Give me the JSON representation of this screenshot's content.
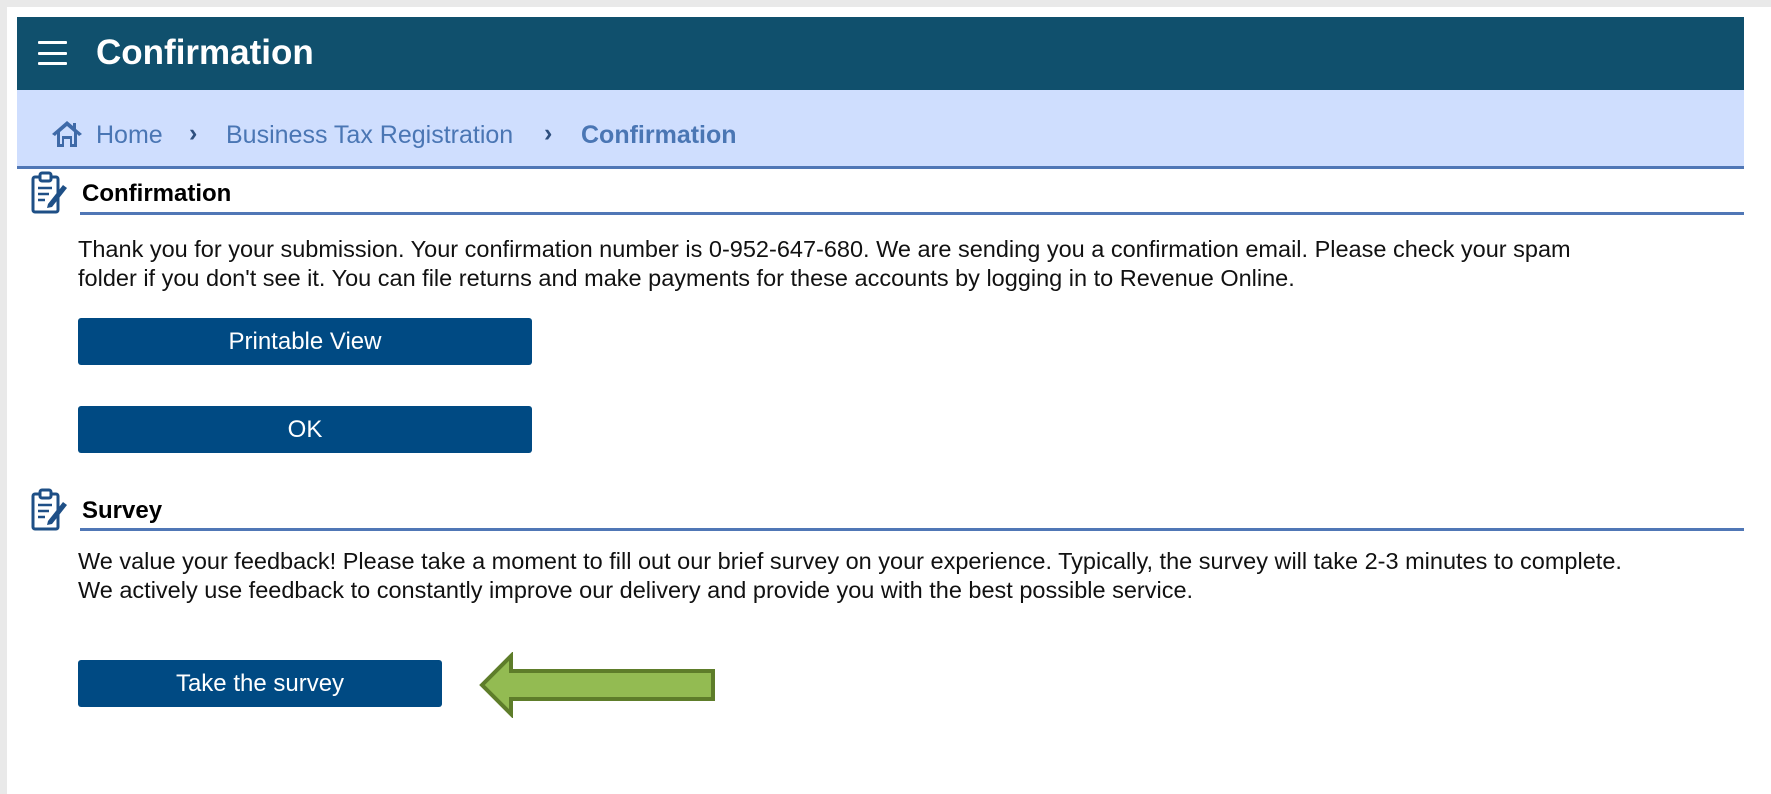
{
  "header": {
    "title": "Confirmation",
    "menu_icon": "hamburger-menu-icon"
  },
  "breadcrumb": {
    "home_icon": "home-icon",
    "items": [
      {
        "label": "Home"
      },
      {
        "label": "Business Tax Registration"
      },
      {
        "label": "Confirmation"
      }
    ],
    "separator": "›"
  },
  "confirmation": {
    "title": "Confirmation",
    "icon": "clipboard-edit-icon",
    "line1": "Thank you for your submission. Your confirmation number is 0-952-647-680. We are sending you a confirmation email. Please check your spam",
    "line2": "folder if you don't see it. You can file returns and make payments for these accounts by logging in to Revenue Online.",
    "printable_label": "Printable View",
    "ok_label": "OK"
  },
  "survey": {
    "title": "Survey",
    "icon": "clipboard-edit-icon",
    "line1": "We value your feedback! Please take a moment to fill out our brief survey on your experience. Typically, the survey will take 2-3 minutes to complete.",
    "line2": "We actively use feedback to constantly improve our delivery and provide you with the best possible service.",
    "survey_button_label": "Take the survey",
    "annotation": "green-arrow-pointer-icon"
  },
  "colors": {
    "header_bg": "#10506d",
    "breadcrumb_bg": "#cfdefe",
    "accent": "#5077b6",
    "button_bg": "#004a83",
    "arrow_fill": "#93bb52",
    "arrow_stroke": "#5e7d2a"
  }
}
